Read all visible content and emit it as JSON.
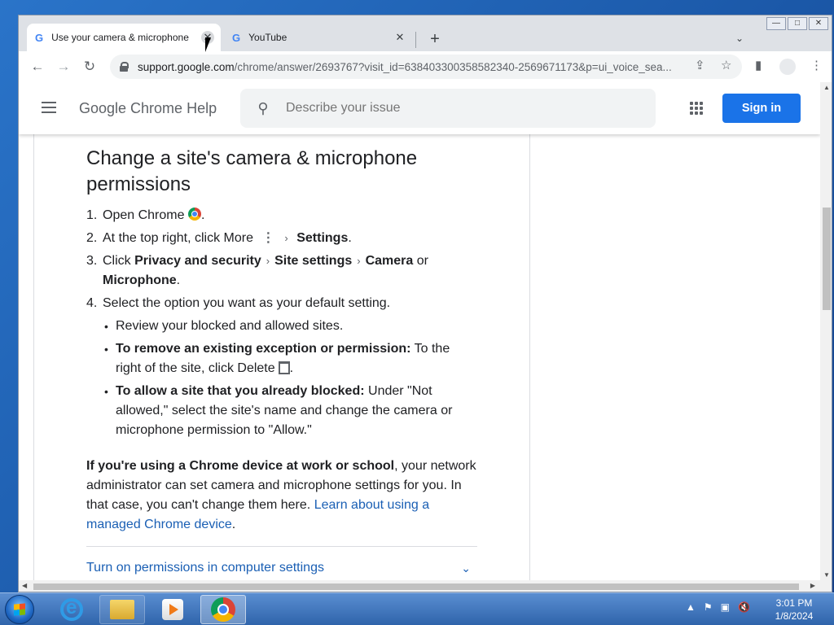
{
  "tabs": [
    {
      "favicon": "G",
      "title": "Use your camera & microphone",
      "close": "✕"
    },
    {
      "favicon": "G",
      "title": "YouTube",
      "close": "✕"
    }
  ],
  "newtab": "+",
  "tabsearch": "⌄",
  "window_controls": {
    "minimize": "—",
    "maximize": "□",
    "close": "✕"
  },
  "omnibox": {
    "url_host": "support.google.com",
    "url_rest": "/chrome/answer/2693767?visit_id=638403300358582340-2569671173&p=ui_voice_sea..."
  },
  "nav": {
    "back": "←",
    "forward": "→",
    "reload": "↻"
  },
  "helpbar": {
    "product_name": "Google Chrome Help",
    "search_placeholder": "Describe your issue",
    "search_icon": "⚲",
    "signin_label": "Sign in"
  },
  "article": {
    "heading": "Change a site's camera & microphone permissions",
    "step1": {
      "num": "1.",
      "text": "Open Chrome",
      "after": "."
    },
    "step2": {
      "num": "2.",
      "text": "At the top right, click More",
      "bold": "Settings",
      "after": "."
    },
    "step3": {
      "num": "3.",
      "text": "Click",
      "bold1": "Privacy and security",
      "bold2": "Site settings",
      "bold3": "Camera",
      "or": "or",
      "bold4": "Microphone",
      "after": "."
    },
    "step4": {
      "num": "4.",
      "text": "Select the option you want as your default setting."
    },
    "bullet1": "Review your blocked and allowed sites.",
    "bullet2": {
      "bold": "To remove an existing exception or permission:",
      "text": "To the right of the site, click Delete",
      "after": "."
    },
    "bullet3": {
      "bold": "To allow a site that you already blocked:",
      "text": "Under \"Not allowed,\" select the site's name and change the camera or microphone permission to \"Allow.\""
    },
    "para_bold": "If you're using a Chrome device at work or school",
    "para_text": ", your network administrator can set camera and microphone settings for you. In that case, you can't change them here.",
    "para_link": "Learn about using a managed Chrome device",
    "para_after": ".",
    "expander": "Turn on permissions in computer settings"
  },
  "taskbar": {
    "tray_icons": [
      "▲",
      "⚑",
      "▣",
      "🔇"
    ],
    "time": "3:01 PM",
    "date": "1/8/2024"
  }
}
